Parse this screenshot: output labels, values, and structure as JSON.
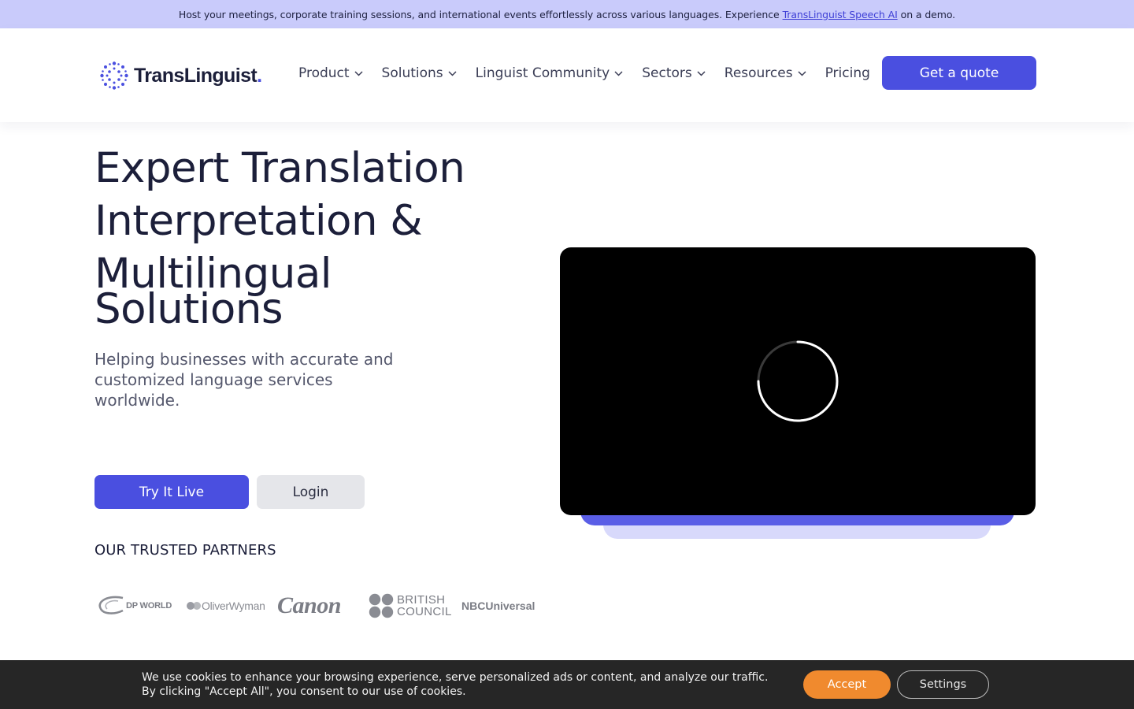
{
  "announcement": {
    "text_before": "Host your meetings, corporate training sessions, and international events effortlessly across various languages. Experience",
    "link_text": "TransLinguist Speech AI",
    "text_after": "on a demo."
  },
  "header": {
    "logo_text": "TransLinguist",
    "logo_dot": ".",
    "nav": [
      {
        "label": "Product",
        "has_dropdown": true
      },
      {
        "label": "Solutions",
        "has_dropdown": true
      },
      {
        "label": "Linguist Community",
        "has_dropdown": true
      },
      {
        "label": "Sectors",
        "has_dropdown": true
      },
      {
        "label": "Resources",
        "has_dropdown": true
      },
      {
        "label": "Pricing",
        "has_dropdown": false
      }
    ],
    "cta_label": "Get a quote"
  },
  "hero": {
    "title_lines": [
      "Expert Translation",
      "Interpretation &",
      "Multilingual",
      "Solutions"
    ],
    "subtitle": "Helping businesses with accurate and customized language services worldwide.",
    "primary_button": "Try It Live",
    "secondary_button": "Login"
  },
  "partners": {
    "title": "OUR TRUSTED PARTNERS",
    "logos": [
      "DP WORLD",
      "OliverWyman",
      "Canon",
      "BRITISH",
      "COUNCIL",
      "NBCUniversal"
    ]
  },
  "cookie": {
    "line1": "We use cookies to enhance your browsing experience, serve personalized ads or content, and analyze our traffic.",
    "line2": "By clicking \"Accept All\", you consent to our use of cookies.",
    "accept_label": "Accept",
    "settings_label": "Settings"
  },
  "colors": {
    "brand": "#4a4fe0",
    "announce_bg": "#c9cbfb",
    "accept": "#f08a2e",
    "cookie_bg": "#262626"
  },
  "icons": {
    "logo": "dotted-globe-icon",
    "dropdown": "chevron-down-icon",
    "video": "loading-spinner-icon",
    "partner_bc": "four-circles-icon",
    "partner_dp": "swoosh-icon",
    "partner_ow": "interlocked-circles-icon"
  }
}
